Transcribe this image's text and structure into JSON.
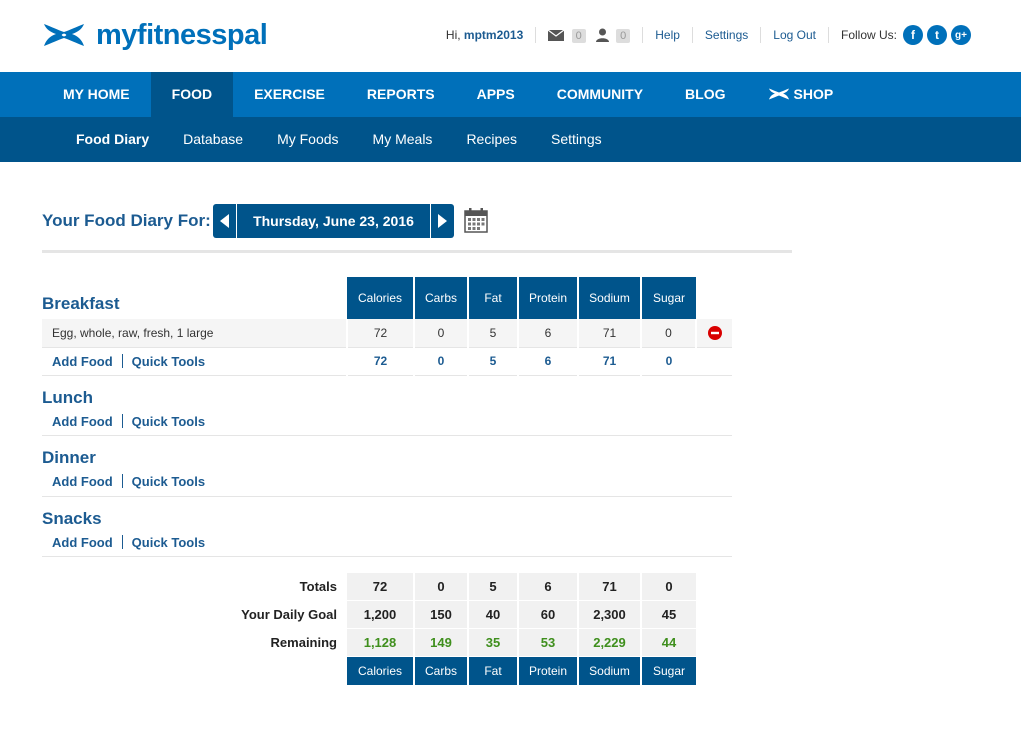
{
  "app": {
    "logo_text": "myfitnesspal"
  },
  "topbar": {
    "greeting": "Hi, ",
    "username": "mptm2013",
    "messages_count": "0",
    "friends_count": "0",
    "help": "Help",
    "settings": "Settings",
    "logout": "Log Out",
    "follow_us": "Follow Us:",
    "social": [
      "f",
      "t",
      "g+"
    ]
  },
  "mainnav": {
    "items": [
      {
        "label": "MY HOME"
      },
      {
        "label": "FOOD"
      },
      {
        "label": "EXERCISE"
      },
      {
        "label": "REPORTS"
      },
      {
        "label": "APPS"
      },
      {
        "label": "COMMUNITY"
      },
      {
        "label": "BLOG"
      },
      {
        "label": "SHOP"
      }
    ],
    "active": "FOOD"
  },
  "subnav": {
    "items": [
      {
        "label": "Food Diary"
      },
      {
        "label": "Database"
      },
      {
        "label": "My Foods"
      },
      {
        "label": "My Meals"
      },
      {
        "label": "Recipes"
      },
      {
        "label": "Settings"
      }
    ],
    "active": "Food Diary"
  },
  "diary": {
    "title": "Your Food Diary For:",
    "date": "Thursday, June 23, 2016",
    "columns": [
      "Calories",
      "Carbs",
      "Fat",
      "Protein",
      "Sodium",
      "Sugar"
    ],
    "add_food": "Add Food",
    "quick_tools": "Quick Tools",
    "meals": [
      {
        "name": "Breakfast",
        "foods": [
          {
            "name": "Egg, whole, raw, fresh, 1 large",
            "values": [
              "72",
              "0",
              "5",
              "6",
              "71",
              "0"
            ]
          }
        ],
        "totals": [
          "72",
          "0",
          "5",
          "6",
          "71",
          "0"
        ]
      },
      {
        "name": "Lunch"
      },
      {
        "name": "Dinner"
      },
      {
        "name": "Snacks"
      }
    ],
    "summary": {
      "totals_label": "Totals",
      "totals": [
        "72",
        "0",
        "5",
        "6",
        "71",
        "0"
      ],
      "goal_label": "Your Daily Goal",
      "goal": [
        "1,200",
        "150",
        "40",
        "60",
        "2,300",
        "45"
      ],
      "remaining_label": "Remaining",
      "remaining": [
        "1,128",
        "149",
        "35",
        "53",
        "2,229",
        "44"
      ]
    }
  },
  "colors": {
    "brand_blue": "#0070ba",
    "dark_blue": "#00548b",
    "link_blue": "#1c5b91",
    "remaining_green": "#3f8f1d",
    "remove_red": "#d90000"
  }
}
